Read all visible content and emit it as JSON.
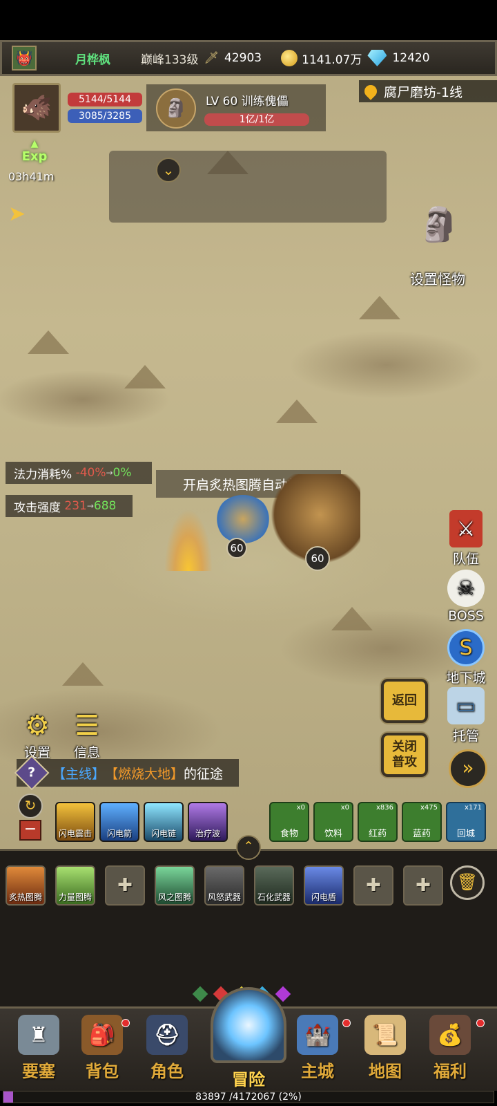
{
  "topbar": {
    "player_name": "月桦枫",
    "peak_level": "巅峰133级",
    "power": "42903",
    "gold": "1141.07万",
    "diamonds": "12420"
  },
  "hero": {
    "hp": "5144/5144",
    "mp": "3085/3285",
    "exp_label": "Exp",
    "exp_timer": "03h41m"
  },
  "target": {
    "name": "LV 60 训练傀儡",
    "hp": "1亿/1亿"
  },
  "location": "腐尸磨坊-1线",
  "set_monster_label": "设置怪物",
  "stats": {
    "mana_cost_label": "法力消耗%",
    "mana_cost_from": "-40%",
    "mana_cost_to": "0%",
    "attack_label": "攻击强度",
    "attack_from": "231",
    "attack_to": "688"
  },
  "cast_banner": "开启炙热图腾自动施法",
  "fighters": {
    "player_level": "60",
    "enemy_level": "60"
  },
  "side_buttons": [
    {
      "label": "队伍",
      "icon": "banner-icon"
    },
    {
      "label": "BOSS",
      "icon": "skull-icon"
    },
    {
      "label": "地下城",
      "icon": "portal-icon"
    },
    {
      "label": "托管",
      "icon": "monitor-icon"
    }
  ],
  "action_buttons": {
    "back": "返回",
    "close_attack": "关闭\n普攻"
  },
  "utilities": {
    "settings": "设置",
    "info": "信息"
  },
  "quest": {
    "tag": "【主线】",
    "name": "【燃烧大地】",
    "suffix": "的征途"
  },
  "skills": [
    {
      "label": "闪电震击"
    },
    {
      "label": "闪电箭"
    },
    {
      "label": "闪电链"
    },
    {
      "label": "治疗波"
    }
  ],
  "consumables": [
    {
      "label": "食物",
      "count": "x0"
    },
    {
      "label": "饮料",
      "count": "x0"
    },
    {
      "label": "红药",
      "count": "x836"
    },
    {
      "label": "蓝药",
      "count": "x475"
    },
    {
      "label": "回城",
      "count": "x171"
    }
  ],
  "totems": [
    {
      "label": "炙热图腾"
    },
    {
      "label": "力量图腾"
    },
    {
      "label": ""
    },
    {
      "label": "风之图腾"
    },
    {
      "label": "风怒武器"
    },
    {
      "label": "石化武器"
    },
    {
      "label": "闪电盾"
    },
    {
      "label": ""
    },
    {
      "label": ""
    }
  ],
  "nav": [
    {
      "label": "要塞"
    },
    {
      "label": "背包"
    },
    {
      "label": "角色"
    },
    {
      "label": "冒险"
    },
    {
      "label": "主城"
    },
    {
      "label": "地图"
    },
    {
      "label": "福利"
    }
  ],
  "progress": {
    "text": "83897 /4172067 (2%)",
    "fraction": 0.02
  },
  "colors": {
    "accent_gold": "#e7b93a",
    "hp_red": "#c23b3b",
    "mp_blue": "#3c5fb8",
    "progress_purple": "#a855c9"
  }
}
